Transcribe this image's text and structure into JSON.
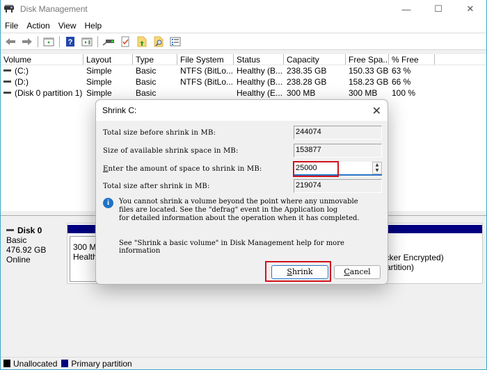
{
  "window": {
    "title": "Disk Management",
    "controls": {
      "minimize": "—",
      "maximize": "☐",
      "close": "✕"
    }
  },
  "menu": [
    "File",
    "Action",
    "View",
    "Help"
  ],
  "toolbar": [
    "back-icon",
    "forward-icon",
    "console-tree-icon",
    "help-icon",
    "action-pane-icon",
    "connect-drive-icon",
    "checklist-icon",
    "folder-up-icon",
    "folder-search-icon",
    "properties-list-icon"
  ],
  "volume_list": {
    "columns": [
      "Volume",
      "Layout",
      "Type",
      "File System",
      "Status",
      "Capacity",
      "Free Spa...",
      "% Free"
    ],
    "rows": [
      {
        "volume": "(C:)",
        "layout": "Simple",
        "type": "Basic",
        "fs": "NTFS (BitLo...",
        "status": "Healthy (B...",
        "capacity": "238.35 GB",
        "free": "150.33 GB",
        "pct": "63 %"
      },
      {
        "volume": "(D:)",
        "layout": "Simple",
        "type": "Basic",
        "fs": "NTFS (BitLo...",
        "status": "Healthy (B...",
        "capacity": "238.28 GB",
        "free": "158.23 GB",
        "pct": "66 %"
      },
      {
        "volume": "(Disk 0 partition 1)",
        "layout": "Simple",
        "type": "Basic",
        "fs": "",
        "status": "Healthy (E...",
        "capacity": "300 MB",
        "free": "300 MB",
        "pct": "100 %"
      }
    ]
  },
  "disk": {
    "name": "Disk 0",
    "type": "Basic",
    "size": "476.92 GB",
    "state": "Online",
    "partition1": {
      "line1": "300 MB",
      "line2": "Healthy"
    },
    "partition2": {
      "line1": "ocker Encrypted)",
      "line2": "Partition)"
    }
  },
  "legend": [
    {
      "label": "Unallocated",
      "color": "#000000"
    },
    {
      "label": "Primary partition",
      "color": "#000080"
    }
  ],
  "dialog": {
    "title": "Shrink C:",
    "close": "✕",
    "fields": {
      "total_before_label": "Total size before shrink in MB:",
      "total_before_value": "244074",
      "available_label": "Size of available shrink space in MB:",
      "available_value": "153877",
      "amount_label_accesskey": "E",
      "amount_label_rest": "nter the amount of space to shrink in MB:",
      "amount_value": "25000",
      "total_after_label": "Total size after shrink in MB:",
      "total_after_value": "219074"
    },
    "info_text": "You cannot shrink a volume beyond the point where any unmovable\nfiles are located. See the \"defrag\" event in the Application log\nfor detailed information about the operation when it has completed.",
    "help_text": "See \"Shrink a basic volume\" in Disk Management help for more\ninformation",
    "shrink_button": {
      "accesskey": "S",
      "rest": "hrink"
    },
    "cancel_button": {
      "accesskey": "C",
      "rest": "ancel"
    },
    "highlight_color": "#d0121b"
  }
}
